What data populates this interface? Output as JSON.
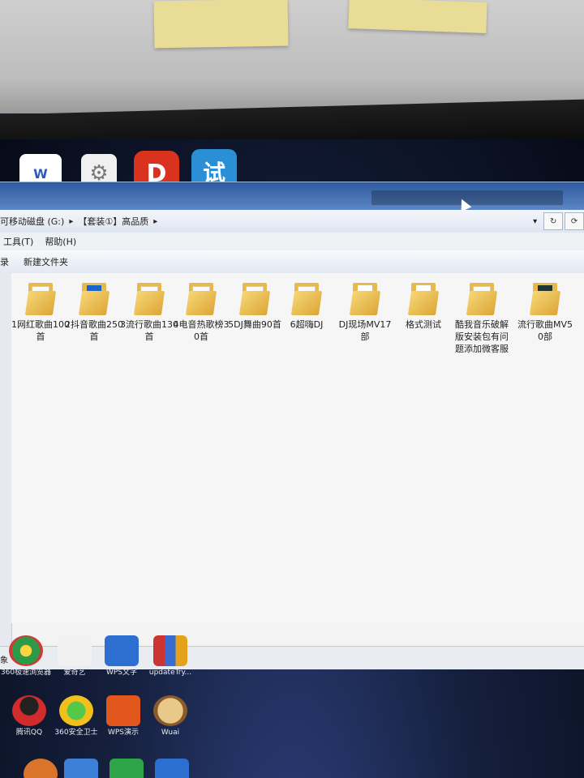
{
  "window": {
    "breadcrumb": [
      "可移动磁盘 (G:)",
      "【套装①】高品质"
    ],
    "menu": [
      "工具(T)",
      "帮助(H)"
    ],
    "toolbar": {
      "left_fragment": "录",
      "new_folder": "新建文件夹"
    },
    "folders": [
      {
        "label": "1网红歌曲100首",
        "thumb": "plain"
      },
      {
        "label": "2抖音歌曲250首",
        "thumb": "blue"
      },
      {
        "label": "3流行歌曲130首",
        "thumb": "plain"
      },
      {
        "label": "4电音热歌榜30首",
        "thumb": "plain"
      },
      {
        "label": "5DJ舞曲90首",
        "thumb": "plain"
      },
      {
        "label": "6超嗨DJ",
        "thumb": "plain"
      },
      {
        "label": "DJ现场MV17部",
        "thumb": "mix"
      },
      {
        "label": "格式测试",
        "thumb": "mix"
      },
      {
        "label": "酷我音乐破解版安装包有问题添加微客服",
        "thumb": "plain"
      },
      {
        "label": "流行歌曲MV50部",
        "thumb": "dark"
      }
    ],
    "status_left": "象"
  },
  "desktop": {
    "top_icons": [
      {
        "name": "word-doc",
        "glyph": "W"
      },
      {
        "name": "settings-doc",
        "glyph": "⚙"
      },
      {
        "name": "pdf-app",
        "glyph": "D"
      },
      {
        "name": "test-app",
        "glyph": "试"
      }
    ],
    "bottom_icons": [
      {
        "label": "360极速浏览器",
        "color": "#3fa34d"
      },
      {
        "label": "爱奇艺",
        "color": "#e8e8e8"
      },
      {
        "label": "WPS文字",
        "color": "#2d6fd1"
      },
      {
        "label": "updateTry...",
        "color": "#d85a2b"
      },
      {
        "label": "腾讯QQ",
        "color": "#d22b2b"
      },
      {
        "label": "360安全卫士",
        "color": "#f2c01b"
      },
      {
        "label": "WPS演示",
        "color": "#e2571e"
      },
      {
        "label": "Wuai",
        "color": "#8b5a2b"
      }
    ]
  },
  "colors": {
    "window_bg": "#f3f3f3",
    "folder": "#e8b94a",
    "titlebar": "#2e5aa0"
  }
}
